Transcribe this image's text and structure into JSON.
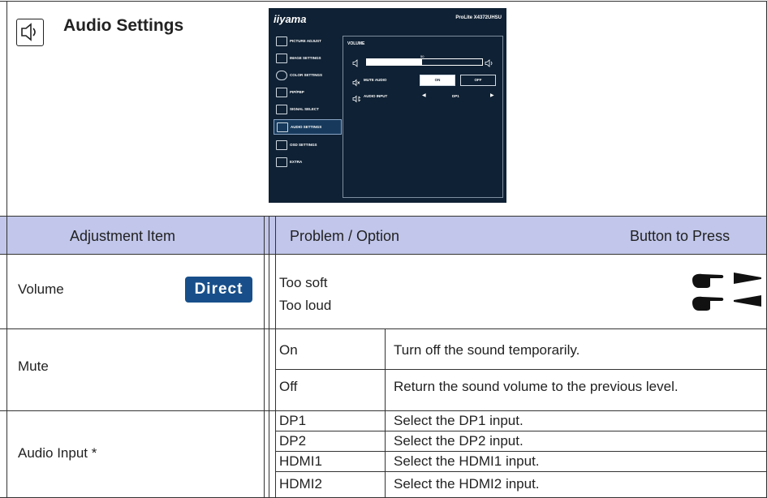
{
  "section": {
    "title": "Audio Settings",
    "icon": "speaker-icon"
  },
  "osd": {
    "brand": "iiyama",
    "model": "ProLite X4372UHSU",
    "menu": [
      {
        "label": "PICTURE ADJUST",
        "icon": "sun-icon"
      },
      {
        "label": "IMAGE SETTINGS",
        "icon": "image-icon"
      },
      {
        "label": "COLOR SETTINGS",
        "icon": "color-icon"
      },
      {
        "label": "PIP/PBP",
        "icon": "pip-icon"
      },
      {
        "label": "SIGNAL SELECT",
        "icon": "input-icon"
      },
      {
        "label": "AUDIO SETTINGS",
        "icon": "speaker-icon",
        "selected": true
      },
      {
        "label": "OSD SETTINGS",
        "icon": "osd-icon"
      },
      {
        "label": "EXTRA",
        "icon": "sliders-icon"
      }
    ],
    "panel_title": "VOLUME",
    "volume_value": "50",
    "volume_fraction": 0.48,
    "mute_label": "MUTE AUDIO",
    "mute_on": "ON",
    "mute_off": "OFF",
    "input_label": "AUDIO INPUT",
    "input_value": "DP1"
  },
  "table": {
    "headers": {
      "item": "Adjustment Item",
      "problem": "Problem / Option",
      "button": "Button to Press"
    },
    "direct_badge": "Direct",
    "volume": {
      "label": "Volume",
      "soft": "Too soft",
      "loud": "Too loud"
    },
    "mute": {
      "label": "Mute",
      "options": [
        {
          "option": "On",
          "desc": "Turn off the sound temporarily."
        },
        {
          "option": "Off",
          "desc": "Return the sound volume to the previous level."
        }
      ]
    },
    "audio_input": {
      "label": "Audio Input *",
      "options": [
        {
          "option": "DP1",
          "desc": "Select the DP1 input."
        },
        {
          "option": "DP2",
          "desc": "Select the DP2 input."
        },
        {
          "option": "HDMI1",
          "desc": "Select the HDMI1 input."
        },
        {
          "option": "HDMI2",
          "desc": "Select the HDMI2 input."
        }
      ]
    }
  },
  "colors": {
    "header_band": "#c1c6ea",
    "direct_badge": "#184f8a",
    "osd_bg": "#0f2134"
  }
}
